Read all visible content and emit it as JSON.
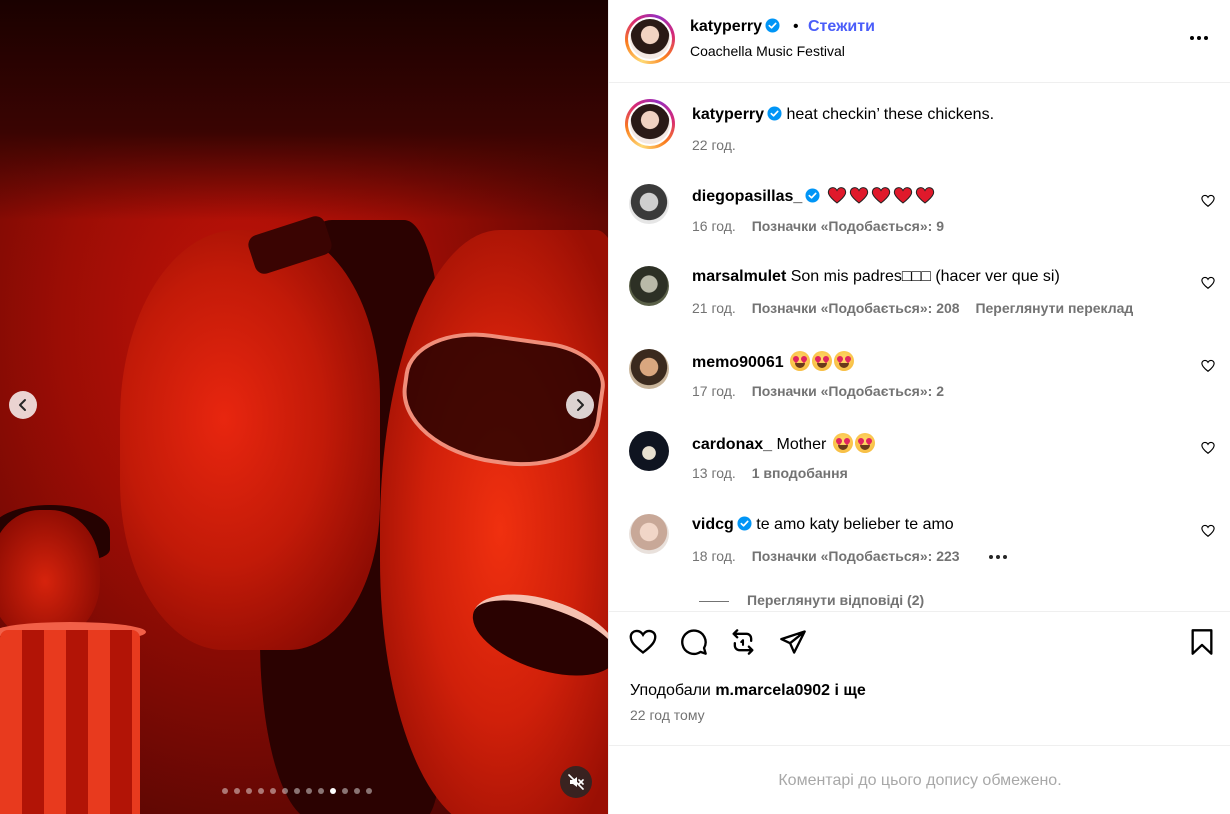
{
  "post": {
    "author": "katyperry",
    "follow_label": "Стежити",
    "separator": "•",
    "location": "Coachella Music Festival",
    "caption": "heat checkin’ these chickens.",
    "caption_time": "22 год."
  },
  "media": {
    "slide_count": 13,
    "active_slide": 10
  },
  "comments": [
    {
      "user": "diegopasillas_",
      "verified": true,
      "text": "",
      "emoji": "heart-x5",
      "time": "16 год.",
      "likes_label": "Позначки «Подобається»: 9",
      "extra": ""
    },
    {
      "user": "marsalmulet",
      "verified": false,
      "text": "Son mis padres□□□ (hacer ver que si)",
      "emoji": "",
      "time": "21 год.",
      "likes_label": "Позначки «Подобається»: 208",
      "extra": "Переглянути переклад"
    },
    {
      "user": "memo90061",
      "verified": false,
      "text": "",
      "emoji": "heart-eyes-x3",
      "time": "17 год.",
      "likes_label": "Позначки «Подобається»: 2",
      "extra": ""
    },
    {
      "user": "cardonax_",
      "verified": false,
      "text": "Mother",
      "emoji": "heart-eyes-x2",
      "time": "13 год.",
      "likes_label": "1 вподобання",
      "extra": ""
    },
    {
      "user": "vidcg",
      "verified": true,
      "text": "te amo katy belieber te amo",
      "emoji": "",
      "time": "18 год.",
      "likes_label": "Позначки «Подобається»: 223",
      "extra": ""
    }
  ],
  "view_replies": "Переглянути відповіді (2)",
  "likes": {
    "prefix": "Уподобали",
    "user": "m.marcela0902",
    "suffix": "і ще"
  },
  "post_time": "22 год тому",
  "comments_limited": "Коментарі до цього допису обмежено.",
  "colors": {
    "accent": "#4a5df9",
    "verified": "#0095f6",
    "muted": "#737373"
  }
}
